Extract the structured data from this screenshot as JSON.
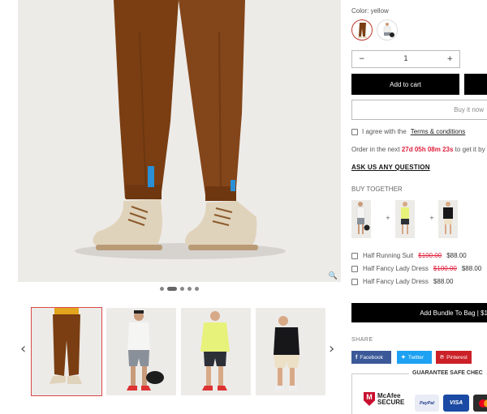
{
  "product": {
    "color_label": "Color: yellow",
    "quantity": "1",
    "qty_minus": "−",
    "qty_plus": "+",
    "add_to_cart": "Add to cart",
    "buy_now": "Buy it now",
    "terms_prefix": "I agree with the",
    "terms_link": "Terms & conditions",
    "order_prefix": "Order in the next",
    "countdown": "27d 05h 08m 23s",
    "order_suffix": "to get it by",
    "ask_question": "ASK US ANY QUESTION"
  },
  "buy_together": {
    "heading": "BUY TOGETHER",
    "plus": "+",
    "items": [
      {
        "name": "Half Running Suit",
        "old_price": "$100.00",
        "price": "$88.00"
      },
      {
        "name": "Half Fancy Lady Dress",
        "old_price": "$100.00",
        "price": "$88.00"
      },
      {
        "name": "Half Fancy Lady Dress",
        "old_price": "",
        "price": "$88.00"
      }
    ],
    "add_bundle": "Add Bundle To Bag | $1"
  },
  "share": {
    "label": "SHARE",
    "facebook": "Facebook",
    "twitter": "Twitter",
    "pinterest": "Pinterest"
  },
  "safe_checkout": {
    "title": "GUARANTEE SAFE CHEC",
    "mcafee_line1": "McAfee",
    "mcafee_line2": "SECURE",
    "paypal": "PayPal",
    "visa": "VISA"
  },
  "gallery": {
    "zoom_icon": "🔍",
    "prev_arrow": "‹",
    "next_arrow": "›"
  },
  "colors": {
    "accent_red": "#e0213d",
    "pants_brown": "#7a3e12",
    "facebook": "#3b5998",
    "twitter": "#1da1f2",
    "pinterest": "#cb2027",
    "background": "#edebe8"
  }
}
